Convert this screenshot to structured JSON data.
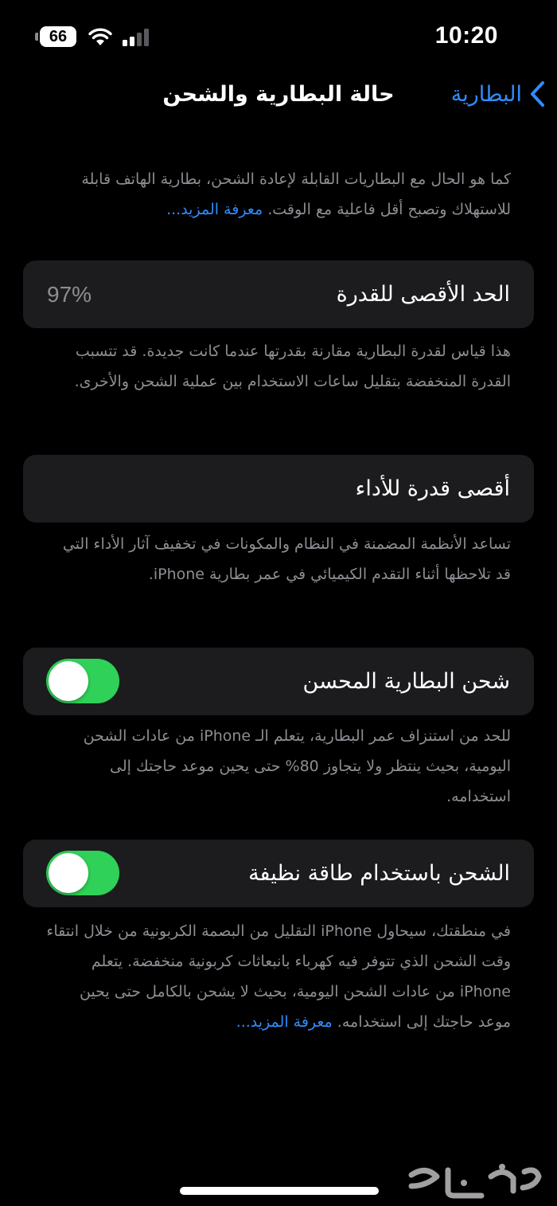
{
  "status_bar": {
    "battery": "66",
    "time": "10:20"
  },
  "nav": {
    "title": "حالة البطارية والشحن",
    "back_label": "البطارية"
  },
  "intro": {
    "text": "كما هو الحال مع البطاريات القابلة لإعادة الشحن، بطارية الهاتف قابلة للاستهلاك وتصبح أقل فاعلية مع الوقت.",
    "link": "معرفة المزيد..."
  },
  "max_capacity": {
    "label": "الحد الأقصى للقدرة",
    "value": "97%",
    "description": "هذا قياس لقدرة البطارية مقارنة بقدرتها عندما كانت جديدة. قد تتسبب القدرة المنخفضة بتقليل ساعات الاستخدام بين عملية الشحن والأخرى."
  },
  "peak_performance": {
    "label": "أقصى قدرة للأداء",
    "description": "تساعد الأنظمة المضمنة في النظام والمكونات في تخفيف آثار الأداء التي قد تلاحظها أثناء التقدم الكيميائي في عمر بطارية iPhone."
  },
  "optimized_charging": {
    "label": "شحن البطارية المحسن",
    "enabled": true,
    "description": "للحد من استنزاف عمر البطارية، يتعلم الـ iPhone من عادات الشحن اليومية، بحيث ينتظر ولا يتجاوز 80% حتى يحين موعد حاجتك إلى استخدامه."
  },
  "clean_energy": {
    "label": "الشحن باستخدام طاقة نظيفة",
    "enabled": true,
    "description": "في منطقتك، سيحاول iPhone التقليل من البصمة الكربونية من خلال انتقاء وقت الشحن الذي تتوفر فيه كهرباء بانبعاثات كربونية منخفضة. يتعلم iPhone من عادات الشحن اليومية، بحيث لا يشحن بالكامل حتى يحين موعد حاجتك إلى استخدامه.",
    "link": "معرفة المزيد..."
  },
  "colors": {
    "background": "#000000",
    "card": "#1c1c1e",
    "accent": "#2f8cff",
    "toggle_on": "#30d158",
    "secondary_text": "#8d8d93"
  }
}
